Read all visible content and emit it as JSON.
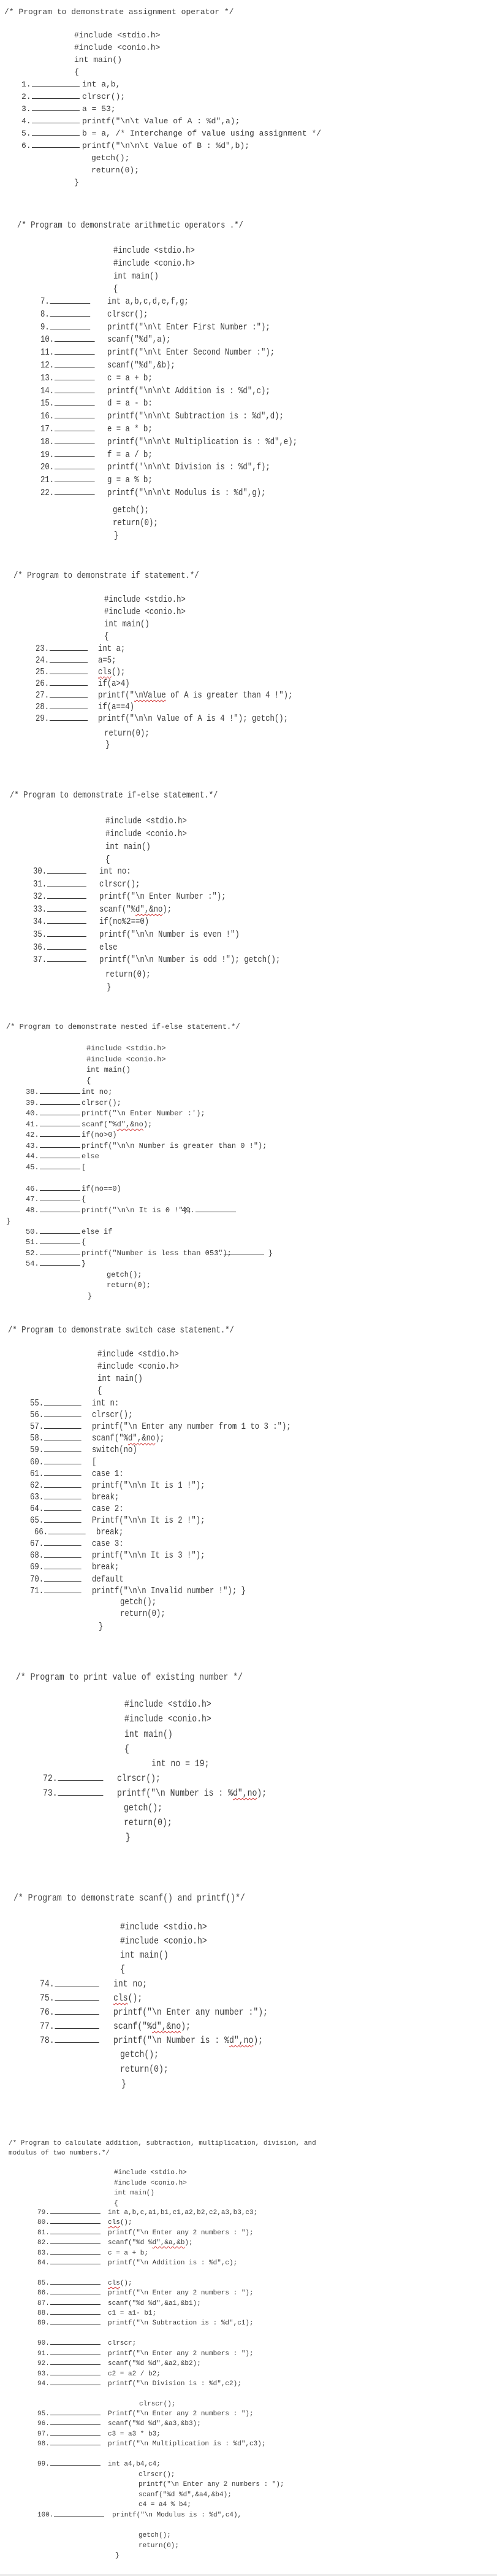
{
  "sections": [
    {
      "title": "/* Program to demonstrate assignment operator */",
      "header_lines": [
        "#include <stdio.h>",
        "#include <conio.h>",
        "int main()",
        "{"
      ],
      "blank_lines": [
        {
          "num": "1.",
          "code": "int a,b,"
        },
        {
          "num": "2.",
          "code": "clrscr();"
        },
        {
          "num": "3.",
          "code": "a = 53;"
        },
        {
          "num": "4.",
          "code": "printf(\"\\n\\t Value of A : %d\",a);"
        },
        {
          "num": "5.",
          "code": "b = a, /* Interchange of value using assignment */"
        },
        {
          "num": "6.",
          "code": "printf(\"\\n\\n\\t Value of B : %d\",b);"
        }
      ],
      "footer_lines": [
        "getch();",
        "return(0);",
        "}"
      ]
    },
    {
      "title": "/* Program to demonstrate arithmetic operators .*/",
      "header_lines": [
        "#include <stdio.h>",
        "#include <conio.h>",
        "int main()",
        "{"
      ],
      "blank_lines": [
        {
          "num": "7.",
          "code": "int a,b,c,d,e,f,g;"
        },
        {
          "num": "8.",
          "code": "clrscr();"
        },
        {
          "num": "9.",
          "code": "printf(\"\\n\\t Enter First Number :\");"
        },
        {
          "num": "10.",
          "code": "scanf(\"%d\",a);"
        },
        {
          "num": "11.",
          "code": "printf(\"\\n\\t Enter Second Number :\");"
        },
        {
          "num": "12.",
          "code": "scanf(\"%d\",&b);"
        },
        {
          "num": "13.",
          "code": "c = a + b;"
        },
        {
          "num": "14.",
          "code": "printf(\"\\n\\n\\t Addition is : %d\",c);"
        },
        {
          "num": "15.",
          "code": "d = a - b:"
        },
        {
          "num": "16.",
          "code": "printf(\"\\n\\n\\t Subtraction is : %d\",d);"
        },
        {
          "num": "17.",
          "code": "e = a * b;"
        },
        {
          "num": "18.",
          "code": "printf(\"\\n\\n\\t Multiplication is : %d\",e);"
        },
        {
          "num": "19.",
          "code": "f = a / b;"
        },
        {
          "num": "20.",
          "code": "printf('\\n\\n\\t Division is : %d\",f);"
        },
        {
          "num": "21.",
          "code": "g = a % b;"
        },
        {
          "num": "22.",
          "code": "printf(\"\\n\\n\\t Modulus is : %d\",g);"
        }
      ],
      "footer_lines": [
        "getch();",
        "return(0);",
        "}"
      ]
    },
    {
      "title": "/* Program to demonstrate if statement.*/",
      "header_lines": [
        "#include <stdio.h>",
        "#include <conio.h>",
        "int main()",
        "{"
      ],
      "blank_lines": [
        {
          "num": "23.",
          "code": "int a;"
        },
        {
          "num": "24.",
          "code": "a=5;"
        },
        {
          "num": "25.",
          "code_parts": [
            {
              "t": "cls",
              "sq": true
            },
            {
              "t": "();"
            }
          ]
        },
        {
          "num": "26.",
          "code": "if(a>4)"
        },
        {
          "num": "27.",
          "code_parts": [
            {
              "t": "printf(\""
            },
            {
              "t": "\\nValue",
              "sq": true
            },
            {
              "t": " of A is greater than 4 !\");"
            }
          ]
        },
        {
          "num": "28.",
          "code": "if(a==4)"
        },
        {
          "num": "29.",
          "code": "printf(\"\\n\\n Value of A is 4 !\"); getch();"
        }
      ],
      "footer_lines": [
        "return(0);",
        "}"
      ]
    },
    {
      "title": "/* Program to demonstrate if-else statement.*/",
      "header_lines": [
        "#include <stdio.h>",
        "#include <conio.h>",
        "int main()",
        "{"
      ],
      "blank_lines": [
        {
          "num": "30.",
          "code": "int no:"
        },
        {
          "num": "31.",
          "code": "clrscr();"
        },
        {
          "num": "32.",
          "code": "printf(\"\\n Enter Number :\");"
        },
        {
          "num": "33.",
          "code_parts": [
            {
              "t": "scanf(\"%"
            },
            {
              "t": "d\",&no",
              "sq": true
            },
            {
              "t": ");"
            }
          ]
        },
        {
          "num": "34.",
          "code": "if(no%2==0)"
        },
        {
          "num": "35.",
          "code": "printf(\"\\n\\n Number is even !\")"
        },
        {
          "num": "36.",
          "code": "else"
        },
        {
          "num": "37.",
          "code": "printf(\"\\n\\n Number is odd !\"); getch();"
        }
      ],
      "footer_lines": [
        "return(0);",
        "}"
      ]
    },
    {
      "title": "/* Program to demonstrate nested if-else statement.*/",
      "header_lines": [
        "#include <stdio.h>",
        "#include <conio.h>",
        "int main()",
        "{"
      ],
      "blank_lines": [
        {
          "num": "38.",
          "code": "int no;"
        },
        {
          "num": "39.",
          "code": "clrscr();"
        },
        {
          "num": "40.",
          "code": "printf(\"\\n Enter Number :');"
        },
        {
          "num": "41.",
          "code_parts": [
            {
              "t": "scanf(\"%"
            },
            {
              "t": "d\",&no",
              "sq": true
            },
            {
              "t": ");"
            }
          ]
        },
        {
          "num": "42.",
          "code": "if(no>0)"
        },
        {
          "num": "43.",
          "code": "printf(\"\\n\\n Number is greater than 0 !\");"
        },
        {
          "num": "44.",
          "code": "else"
        },
        {
          "num": "45.",
          "code": "["
        },
        {
          "num": "46.",
          "code": "if(no==0)"
        },
        {
          "num": "47.",
          "code": "{"
        },
        {
          "num": "48.",
          "code": "printf(\"\\n\\n It is 0 !\");",
          "trailing_num": "49."
        },
        {
          "num": "50.",
          "code": "else if"
        },
        {
          "num": "51.",
          "code": "{"
        },
        {
          "num": "52.",
          "code": "printf(\"Number is less than 0 !\");",
          "trailing_num": "53.",
          "trailing_code": "}"
        },
        {
          "num": "54.",
          "code": "}"
        }
      ],
      "stray_brace": "}",
      "footer_lines": [
        "getch();",
        "return(0);",
        "}"
      ]
    },
    {
      "title": "/* Program to demonstrate switch case statement.*/",
      "header_lines": [
        "#include <stdio.h>",
        "#include <conio.h>",
        "int main()",
        "{"
      ],
      "blank_lines": [
        {
          "num": "55.",
          "code": "int n:"
        },
        {
          "num": "56.",
          "code": "clrscr();"
        },
        {
          "num": "57.",
          "code": "printf(\"\\n Enter any number from 1 to 3 :\");"
        },
        {
          "num": "58.",
          "code_parts": [
            {
              "t": "scanf(\"%"
            },
            {
              "t": "d\",&no",
              "sq": true
            },
            {
              "t": ");"
            }
          ]
        },
        {
          "num": "59.",
          "code": "switch(no)"
        },
        {
          "num": "60.",
          "code": "["
        },
        {
          "num": "61.",
          "code": "case 1:"
        },
        {
          "num": "62.",
          "code": "printf(\"\\n\\n It is 1 !\");"
        },
        {
          "num": "63.",
          "code": "break;"
        },
        {
          "num": "64.",
          "code": "case 2:"
        },
        {
          "num": "65.",
          "code": "Printf(\"\\n\\n It is 2 !\");"
        },
        {
          "num": "66.",
          "code": "break;"
        },
        {
          "num": "67.",
          "code": "case 3:"
        },
        {
          "num": "68.",
          "code": "printf(\"\\n\\n It is 3 !\");"
        },
        {
          "num": "69.",
          "code": "break;"
        },
        {
          "num": "70.",
          "code": "default"
        },
        {
          "num": "71.",
          "code": "printf(\"\\n\\n Invalid number !\"); }"
        }
      ],
      "footer_lines": [
        "getch();",
        "return(0);",
        "}"
      ]
    },
    {
      "title": "/* Program to print value of existing number */",
      "header_lines": [
        "#include <stdio.h>",
        "#include <conio.h>",
        "int main()",
        "{",
        "int no = 19;"
      ],
      "blank_lines": [
        {
          "num": "72.",
          "code": "clrscr();"
        },
        {
          "num": "73.",
          "code_parts": [
            {
              "t": "printf(\"\\n Number is : %"
            },
            {
              "t": "d\",no",
              "sq": true
            },
            {
              "t": ");"
            }
          ]
        }
      ],
      "footer_lines": [
        "getch();",
        "return(0);",
        "}"
      ]
    },
    {
      "title": "/* Program to demonstrate scanf() and printf()*/",
      "header_lines": [
        "#include <stdio.h>",
        "#include <conio.h>",
        "int main()",
        "{"
      ],
      "blank_lines": [
        {
          "num": "74.",
          "code": "int no;"
        },
        {
          "num": "75.",
          "code_parts": [
            {
              "t": "cls",
              "sq": true
            },
            {
              "t": "();"
            }
          ]
        },
        {
          "num": "76.",
          "code": "printf(\"\\n Enter any number :\");"
        },
        {
          "num": "77.",
          "code_parts": [
            {
              "t": "scanf(\"%"
            },
            {
              "t": "d\",&no",
              "sq": true
            },
            {
              "t": ");"
            }
          ]
        },
        {
          "num": "78.",
          "code_parts": [
            {
              "t": "printf(\"\\n Number is : %"
            },
            {
              "t": "d\",no",
              "sq": true
            },
            {
              "t": ");"
            }
          ]
        }
      ],
      "footer_lines": [
        "getch();",
        "return(0);",
        "}"
      ]
    },
    {
      "title": "/* Program to calculate addition, subtraction, multiplication, division, and",
      "title_line2": "modulus of two numbers.*/",
      "header_lines": [
        "#include <stdio.h>",
        "#include <conio.h>",
        "int main()",
        "{"
      ],
      "blank_lines": [
        {
          "num": "79.",
          "code": "int a,b,c,a1,b1,c1,a2,b2,c2,a3,b3,c3;"
        },
        {
          "num": "80.",
          "code_parts": [
            {
              "t": "cls",
              "sq": true
            },
            {
              "t": "();"
            }
          ]
        },
        {
          "num": "81.",
          "code": "printf(\"\\n Enter any 2 numbers : \");"
        },
        {
          "num": "82.",
          "code_parts": [
            {
              "t": "scanf(\"%d %"
            },
            {
              "t": "d\",&a,&b",
              "sq": true
            },
            {
              "t": ");"
            }
          ]
        },
        {
          "num": "83.",
          "code": "c = a + b;"
        },
        {
          "num": "84.",
          "code": "printf(\"\\n Addition is : %d\",c);"
        },
        {
          "num": "85.",
          "code_parts": [
            {
              "t": "cls",
              "sq": true
            },
            {
              "t": "();"
            }
          ]
        },
        {
          "num": "86.",
          "code": "printf(\"\\n Enter any 2 numbers : \");"
        },
        {
          "num": "87.",
          "code": "scanf(\"%d %d\",&a1,&b1);"
        },
        {
          "num": "88.",
          "code": "c1 = a1- b1;"
        },
        {
          "num": "89.",
          "code": "printf(\"\\n Subtraction is : %d\",c1);"
        },
        {
          "num": "90.",
          "code": "clrscr;"
        },
        {
          "num": "91.",
          "code": "printf(\"\\n Enter any 2 numbers : \");"
        },
        {
          "num": "92.",
          "code": "scanf(\"%d %d\",&a2,&b2);"
        },
        {
          "num": "93.",
          "code": "c2 = a2 / b2;"
        },
        {
          "num": "94.",
          "code": "printf(\"\\n Division is : %d\",c2);"
        },
        {
          "num": "95.",
          "code": "Printf(\"\\n Enter any 2 numbers : \");"
        },
        {
          "num": "96.",
          "code": "scanf(\"%d %d\",&a3,&b3);"
        },
        {
          "num": "97.",
          "code": "c3 = a3 * b3;"
        },
        {
          "num": "98.",
          "code": "printf(\"\\n Multiplication is : %d\",c3);"
        },
        {
          "num": "99.",
          "code": "int a4,b4,c4;"
        },
        {
          "num": "100.",
          "code": "printf(\"\\n Modulus is : %d\",c4),"
        }
      ],
      "mid_lines": {
        "before_95": "clrscr();",
        "after_99": [
          "clrscr();",
          "printf(\"\\n Enter any 2 numbers : \");",
          "scanf(\"%d %d\",&a4,&b4);",
          "c4 = a4 % b4;"
        ]
      },
      "footer_lines": [
        "getch();",
        "return(0);",
        "}"
      ]
    }
  ]
}
